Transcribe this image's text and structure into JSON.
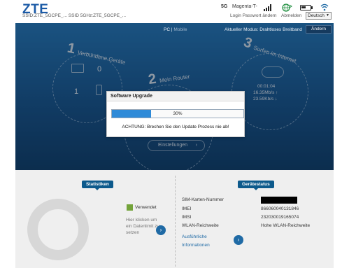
{
  "header": {
    "logo": "ZTE",
    "ssid": "SSID:ZTE_5GCPE_...  SSID 5GHz:ZTE_5GCPE_...",
    "network_type": "5G",
    "carrier": "Magenta-T-",
    "login_link": "Login Passwort ändern",
    "logout_link": "Abmelden",
    "language": "Deutsch"
  },
  "hero": {
    "view_pc": "PC",
    "view_separator": " | ",
    "view_mobile": "Mobile",
    "mode_label": "Aktueller Modus: Drahtloses Breitband",
    "change_button": "Ändern",
    "section1_num": "1",
    "section1_label": "Verbundene Geräte",
    "section2_num": "2",
    "section2_label": "Mein Router",
    "section3_num": "3",
    "section3_label": "Surfen im Internet",
    "wired_count": "0",
    "wireless_count": "1",
    "connection_time": "00:01:04",
    "upload_rate": "16.35Mb/s ↑",
    "download_rate": "23.59Kb/s ↓",
    "settings_button": "Einstellungen",
    "settings_arrow": "›"
  },
  "modal": {
    "title": "Software Upgrade",
    "progress_percent": 30,
    "progress_text": "30%",
    "warning": "ACHTUNG: Brechen Sie den Update Prozess nie ab!"
  },
  "stats": {
    "badge": "Statistiken",
    "legend_used": "Verwendet",
    "hint": "Hier klicken um ein Datenlimit zu setzen",
    "arrow": "›"
  },
  "device_status": {
    "badge": "Gerätestatus",
    "sim_label": "SIM-Karten-Nummer",
    "imei_label": "IMEI",
    "imei_value": "866060040131846",
    "imsi_label": "IMSI",
    "imsi_value": "232030019165074",
    "wlan_label": "WLAN-Reichweite",
    "wlan_value": "Hohe WLAN-Reichweite",
    "more_info": "Ausführliche Informationen",
    "arrow": "›"
  },
  "colors": {
    "brand": "#1b5aa6",
    "progress": "#2e8ad8",
    "badge": "#0d5a8c",
    "used": "#73a33a"
  }
}
